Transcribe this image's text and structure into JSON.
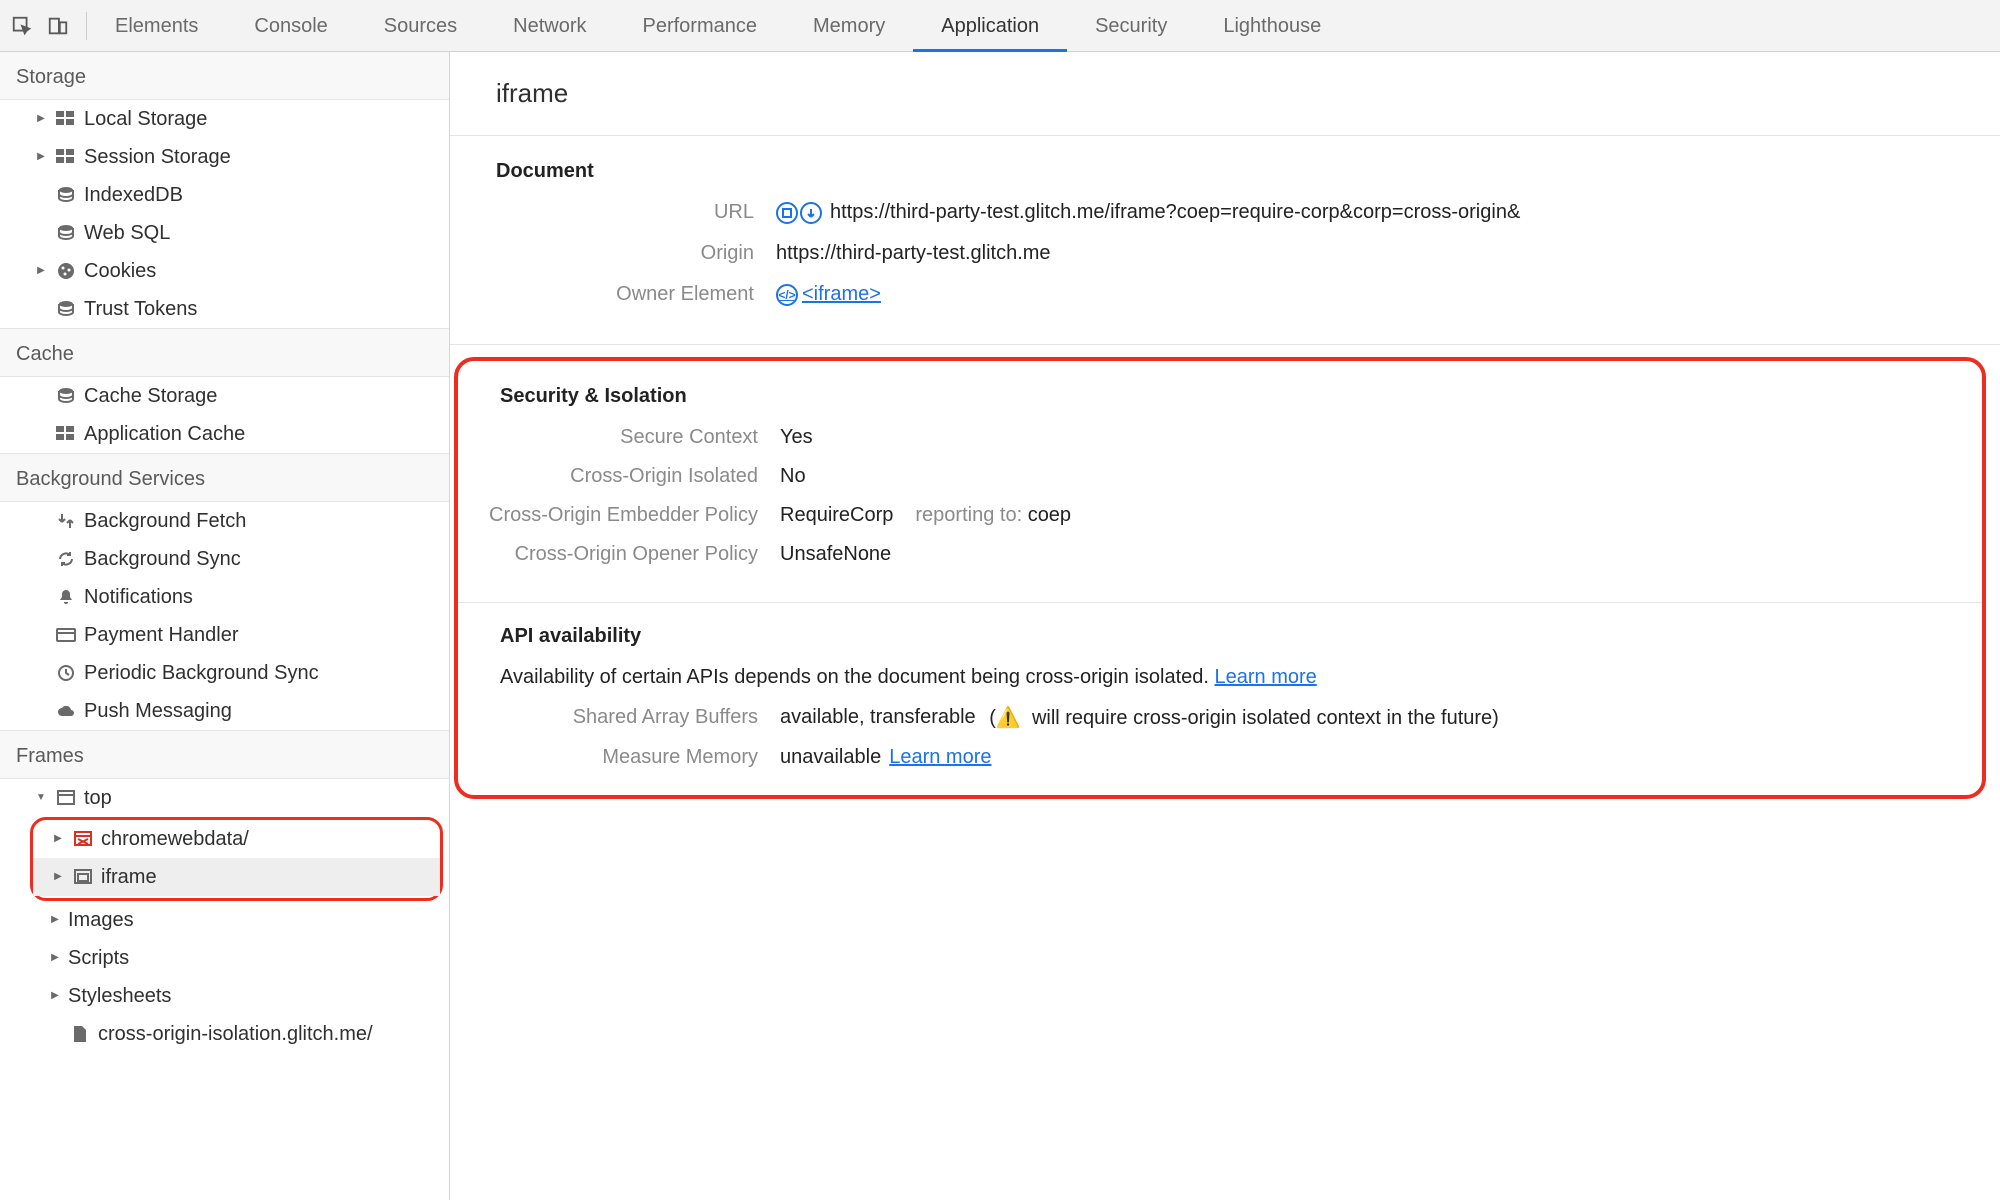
{
  "tabs": {
    "elements": "Elements",
    "console": "Console",
    "sources": "Sources",
    "network": "Network",
    "performance": "Performance",
    "memory": "Memory",
    "application": "Application",
    "security": "Security",
    "lighthouse": "Lighthouse"
  },
  "sidebar": {
    "storage": {
      "header": "Storage",
      "items": {
        "local": "Local Storage",
        "session": "Session Storage",
        "indexeddb": "IndexedDB",
        "websql": "Web SQL",
        "cookies": "Cookies",
        "trust": "Trust Tokens"
      }
    },
    "cache": {
      "header": "Cache",
      "items": {
        "cache_storage": "Cache Storage",
        "app_cache": "Application Cache"
      }
    },
    "bg": {
      "header": "Background Services",
      "items": {
        "fetch": "Background Fetch",
        "sync": "Background Sync",
        "notif": "Notifications",
        "payment": "Payment Handler",
        "periodic": "Periodic Background Sync",
        "push": "Push Messaging"
      }
    },
    "frames": {
      "header": "Frames",
      "top": "top",
      "chromewebdata": "chromewebdata/",
      "iframe": "iframe",
      "images": "Images",
      "scripts": "Scripts",
      "stylesheets": "Stylesheets",
      "coi": "cross-origin-isolation.glitch.me/"
    }
  },
  "detail": {
    "title": "iframe",
    "doc": {
      "header": "Document",
      "url_label": "URL",
      "url_value": "https://third-party-test.glitch.me/iframe?coep=require-corp&corp=cross-origin&",
      "origin_label": "Origin",
      "origin_value": "https://third-party-test.glitch.me",
      "owner_label": "Owner Element",
      "owner_value": "<iframe>"
    },
    "sec": {
      "header": "Security & Isolation",
      "secure_label": "Secure Context",
      "secure_value": "Yes",
      "coi_label": "Cross-Origin Isolated",
      "coi_value": "No",
      "coep_label": "Cross-Origin Embedder Policy",
      "coep_value": "RequireCorp",
      "coep_rep_label": "reporting to:",
      "coep_rep_value": "coep",
      "coop_label": "Cross-Origin Opener Policy",
      "coop_value": "UnsafeNone"
    },
    "api": {
      "header": "API availability",
      "desc": "Availability of certain APIs depends on the document being cross-origin isolated.",
      "learn_more": "Learn more",
      "sab_label": "Shared Array Buffers",
      "sab_value": "available, transferable",
      "sab_warn": "will require cross-origin isolated context in the future)",
      "mem_label": "Measure Memory",
      "mem_value": "unavailable"
    }
  }
}
